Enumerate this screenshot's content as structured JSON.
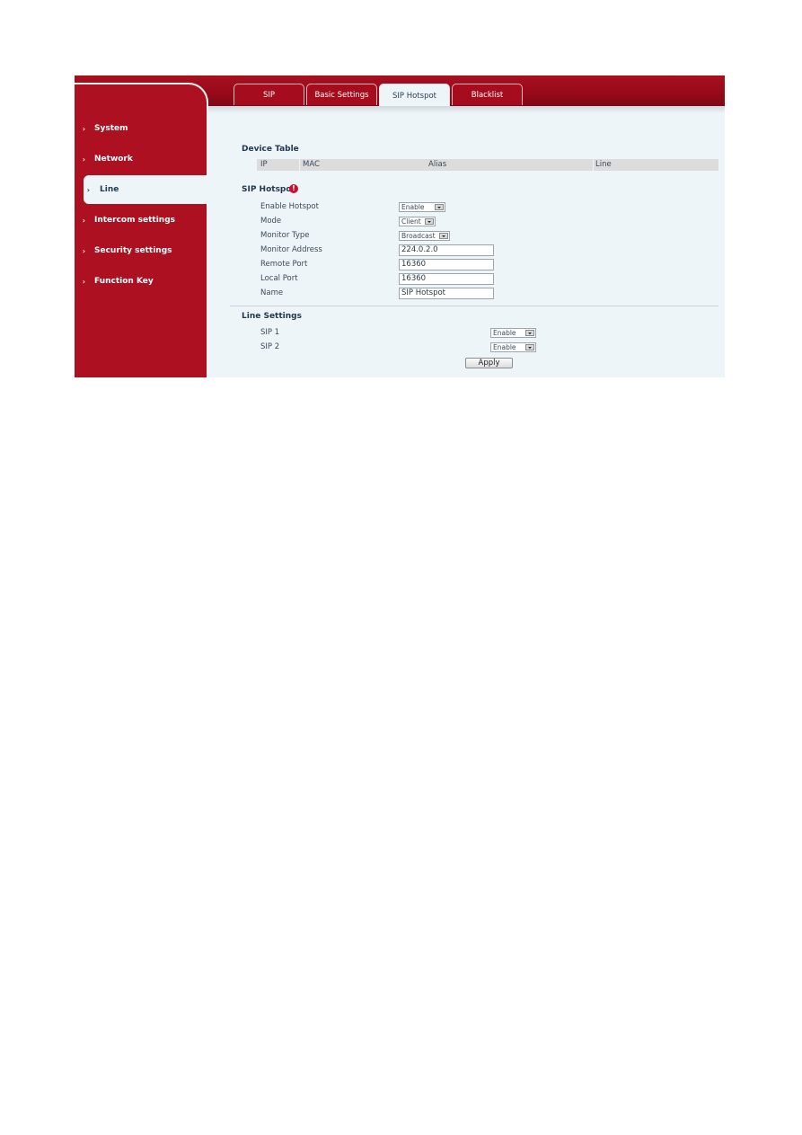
{
  "tabs": [
    {
      "label": "SIP",
      "active": false
    },
    {
      "label": "Basic Settings",
      "active": false
    },
    {
      "label": "SIP Hotspot",
      "active": true
    },
    {
      "label": "Blacklist",
      "active": false
    }
  ],
  "sidebar": {
    "items": [
      {
        "label": "System",
        "active": false
      },
      {
        "label": "Network",
        "active": false
      },
      {
        "label": "Line",
        "active": true
      },
      {
        "label": "Intercom settings",
        "active": false
      },
      {
        "label": "Security settings",
        "active": false
      },
      {
        "label": "Function Key",
        "active": false
      }
    ],
    "chevron": "›"
  },
  "device_table": {
    "title": "Device Table",
    "columns": [
      "IP",
      "MAC",
      "Alias",
      "Line"
    ],
    "rows": []
  },
  "sip_hotspot": {
    "title": "SIP Hotspot",
    "info_icon": "!",
    "fields": {
      "enable_hotspot": {
        "label": "Enable Hotspot",
        "value": "Enable"
      },
      "mode": {
        "label": "Mode",
        "value": "Client"
      },
      "monitor_type": {
        "label": "Monitor Type",
        "value": "Broadcast"
      },
      "monitor_address": {
        "label": "Monitor Address",
        "value": "224.0.2.0"
      },
      "remote_port": {
        "label": "Remote Port",
        "value": "16360"
      },
      "local_port": {
        "label": "Local Port",
        "value": "16360"
      },
      "name": {
        "label": "Name",
        "value": "SIP Hotspot"
      }
    }
  },
  "line_settings": {
    "title": "Line Settings",
    "lines": [
      {
        "label": "SIP 1",
        "value": "Enable"
      },
      {
        "label": "SIP 2",
        "value": "Enable"
      }
    ]
  },
  "apply_label": "Apply",
  "colors": {
    "brand_red": "#a50d1e",
    "content_bg": "#eef5f8",
    "info_red": "#c8102e"
  }
}
